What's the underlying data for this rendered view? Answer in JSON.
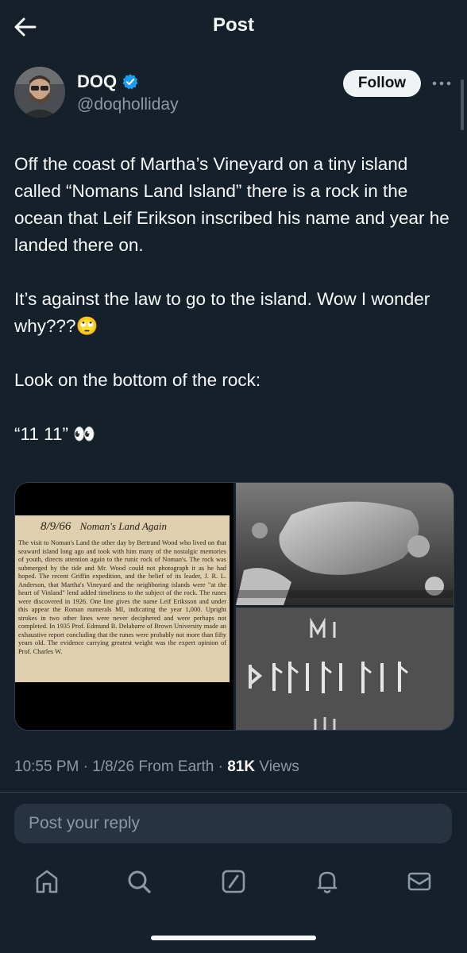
{
  "header": {
    "title": "Post"
  },
  "author": {
    "name": "DOQ",
    "handle": "@doqholliday",
    "follow_label": "Follow"
  },
  "post": {
    "p1": "Off the coast of Martha’s Vineyard on a tiny island called “Nomans Land Island” there is a rock in the ocean that Leif Erikson inscribed his name and year he landed there on.",
    "p2": "It’s against the law to go to the island. Wow I wonder why???🙄",
    "p3": "Look on the bottom of the rock:",
    "p4": "“11 11” 👀"
  },
  "clipping": {
    "date": "8/9/66",
    "headline": "Noman's Land Again",
    "text": "The visit to Noman's Land the other day by Bertrand Wood who lived on that seaward island long ago and took with him many of the nostalgic memories of youth, directs attention again to the runic rock of Noman's. The rock was submerged by the tide and Mr. Wood could not photograph it as he had hoped. The recent Griffin expedition, and the belief of its leader, J. R. L. Anderson, that Martha's Vineyard and the neighboring islands were \"at the heart of Vinland\" lend added timeliness to the subject of the rock. The runes were discovered in 1926. One line gives the name Leif Eriksson and under this appear the Roman numerals MI, indicating the year 1,000. Upright strokes in two other lines were never deciphered and were perhaps not completed. In 1935 Prof. Edmund B. Delabarre of Brown University made an exhaustive report concluding that the runes were probably not more than fifty years old. The evidence carrying greatest weight was the expert opinion of Prof. Charles W."
  },
  "meta": {
    "time": "10:55 PM",
    "sep1": " · ",
    "date": "1/8/26 From Earth",
    "sep2": " · ",
    "views_count": "81K",
    "views_label": " Views"
  },
  "reply": {
    "placeholder": "Post your reply"
  },
  "nav": {
    "items": [
      "home-icon",
      "search-icon",
      "grok-icon",
      "notifications-icon",
      "messages-icon"
    ]
  },
  "colors": {
    "background": "#15202b",
    "accent": "#1d9bf0",
    "secondary_text": "#8b98a5"
  }
}
